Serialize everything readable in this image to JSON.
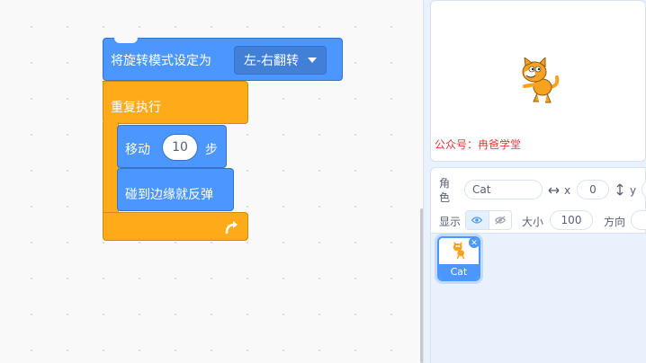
{
  "blocks": {
    "set_rotation_label": "将旋转模式设定为",
    "rotation_value": "左-右翻转",
    "repeat_label": "重复执行",
    "move_label": "移动",
    "move_steps": "10",
    "move_unit": "步",
    "bounce_label": "碰到边缘就反弹",
    "loop_arrow": "↻"
  },
  "stage": {
    "watermark": "公众号：冉爸学堂"
  },
  "sprite_info": {
    "sprite_label": "角色",
    "sprite_name": "Cat",
    "x_label": "x",
    "x_value": "0",
    "y_label": "y",
    "show_label": "显示",
    "size_label": "大小",
    "size_value": "100",
    "direction_label": "方向"
  },
  "sprite_list": {
    "items": [
      {
        "name": "Cat"
      }
    ]
  },
  "colors": {
    "motion": "#4c97ff",
    "control": "#ffab19",
    "watermark": "#e4393c"
  }
}
